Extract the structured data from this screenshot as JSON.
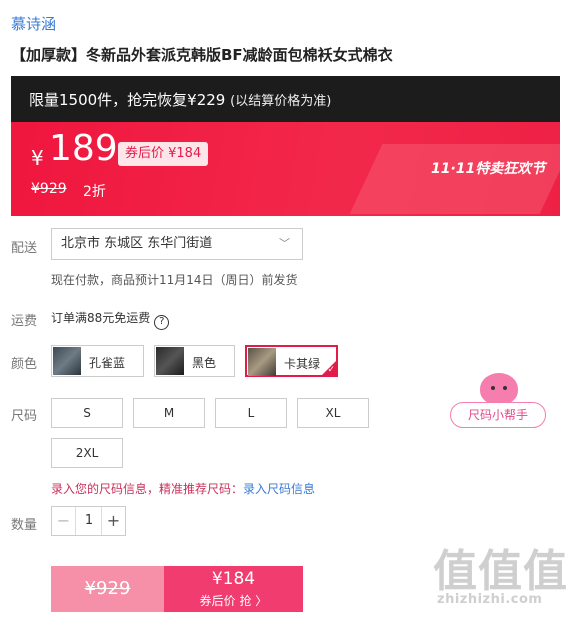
{
  "shop_name": "慕诗涵",
  "product_title": "【加厚款】冬新品外套派克韩版BF减龄面包棉袄女式棉衣",
  "promo": {
    "main": "限量1500件，抢完恢复¥229",
    "sub": "(以结算价格为准)"
  },
  "price": {
    "currency": "¥",
    "current": "189",
    "coupon_badge": "券后价 ¥184",
    "original": "¥929",
    "discount": "2折",
    "festival": "11·11特卖狂欢节",
    "accent_color": "#f0163e"
  },
  "shipping": {
    "label": "配送",
    "address": "北京市 东城区 东华门街道",
    "ship_time": "现在付款，商品预计11月14日（周日）前发货"
  },
  "freight": {
    "label": "运费",
    "text": "订单满88元免运费",
    "help_icon": "?"
  },
  "colors": {
    "label": "颜色",
    "options": [
      {
        "name": "孔雀蓝",
        "selected": false
      },
      {
        "name": "黑色",
        "selected": false
      },
      {
        "name": "卡其绿",
        "selected": true
      }
    ]
  },
  "sizes": {
    "label": "尺码",
    "options": [
      "S",
      "M",
      "L",
      "XL",
      "2XL"
    ],
    "helper": "尺码小帮手",
    "tip": "录入您的尺码信息，精准推荐尺码：",
    "tip_link": "录入尺码信息"
  },
  "quantity": {
    "label": "数量",
    "value": "1",
    "minus": "−",
    "plus": "+"
  },
  "buy": {
    "original": "¥929",
    "price": "¥184",
    "action": "券后价 抢 〉"
  },
  "watermark": {
    "big": "值值值",
    "small": "zhizhizhi.com"
  }
}
